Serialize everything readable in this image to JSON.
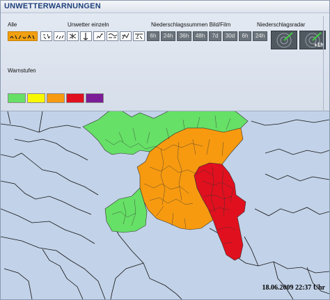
{
  "title": "UNWETTERWARNUNGEN",
  "filters": {
    "all_label": "Alle",
    "single_label": "Unwetter einzeln",
    "precip_label": "Niederschlagssummen Bild/Film",
    "radar_label": "Niederschlagsradar",
    "precip_buttons": [
      "6h",
      "24h",
      "36h",
      "48h",
      "7d",
      "30d",
      "6h",
      "24h"
    ],
    "radar_plus": "+1h"
  },
  "levels": {
    "label": "Warnstufen",
    "colors": [
      "#66e066",
      "#f8f800",
      "#f79a10",
      "#e0101e",
      "#7b1d96"
    ]
  },
  "map": {
    "timestamp": "18.06.2009 22:37 Uhr",
    "colors": {
      "background": "#c2d2e8",
      "green": "#66e066",
      "orange": "#f79a10",
      "red": "#e0101e"
    }
  }
}
